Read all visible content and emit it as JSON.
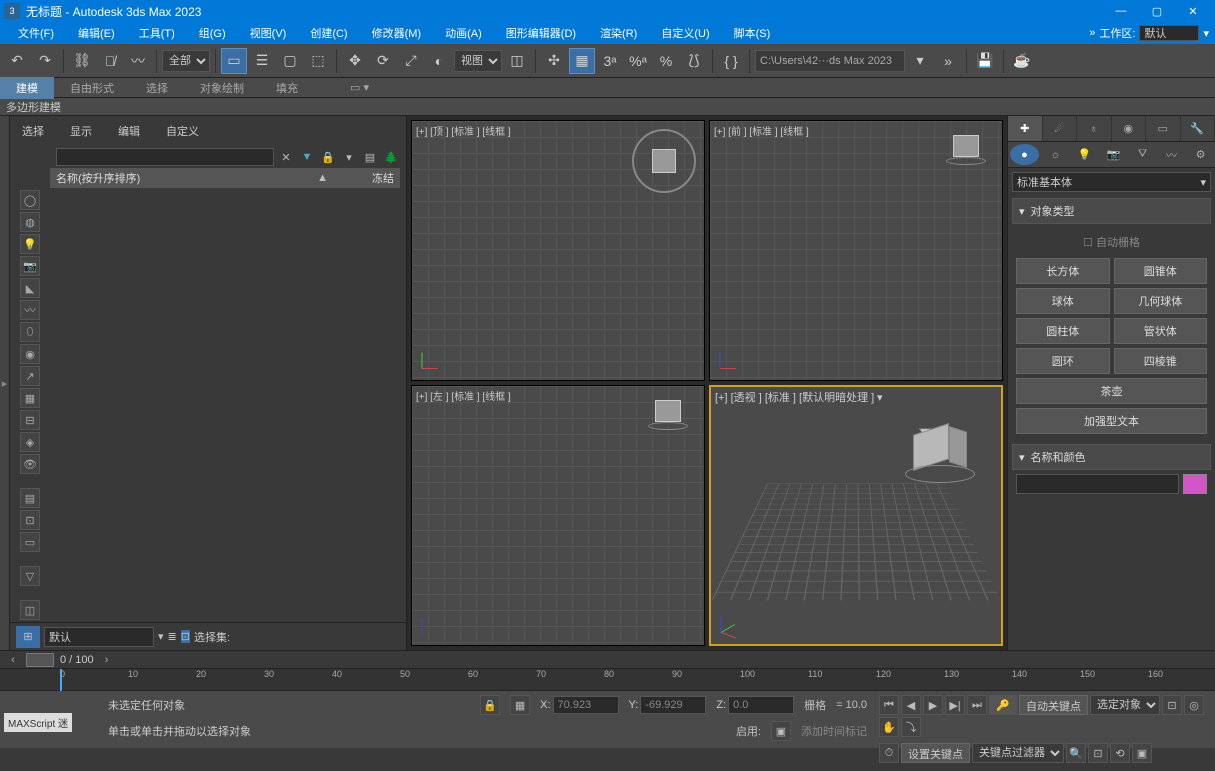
{
  "title": "无标题 - Autodesk 3ds Max 2023",
  "menu": [
    "文件(F)",
    "编辑(E)",
    "工具(T)",
    "组(G)",
    "视图(V)",
    "创建(C)",
    "修改器(M)",
    "动画(A)",
    "图形编辑器(D)",
    "渲染(R)",
    "自定义(U)",
    "脚本(S)"
  ],
  "workspace": {
    "label": "工作区:",
    "value": "默认"
  },
  "toolbar": {
    "filter": "全部",
    "refsys": "视图",
    "path": "C:\\Users\\42···ds Max 2023"
  },
  "ribbon": {
    "tabs": [
      "建模",
      "自由形式",
      "选择",
      "对象绘制",
      "填充"
    ],
    "sub": "多边形建模"
  },
  "scene": {
    "tabs": [
      "选择",
      "显示",
      "编辑",
      "自定义"
    ],
    "col_name": "名称(按升序排序)",
    "col_freeze": "冻结",
    "layer_default": "默认",
    "selset_label": "选择集:"
  },
  "viewports": {
    "top": "[+] [顶 ] [标准 ] [线框 ]",
    "front": "[+] [前 ] [标准 ] [线框 ]",
    "left": "[+] [左 ] [标准 ] [线框 ]",
    "persp": "[+]  [透视 ]  [标准 ]  [默认明暗处理 ]"
  },
  "cmd": {
    "category": "标准基本体",
    "rollout_objtype": "对象类型",
    "autogrid": "自动栅格",
    "buttons": [
      [
        "长方体",
        "圆锥体"
      ],
      [
        "球体",
        "几何球体"
      ],
      [
        "圆柱体",
        "管状体"
      ],
      [
        "圆环",
        "四棱锥"
      ],
      [
        "茶壶",
        ""
      ],
      [
        "加强型文本",
        ""
      ]
    ],
    "rollout_name": "名称和颜色",
    "name_value": ""
  },
  "time": {
    "frames": "0 / 100"
  },
  "ticks": [
    0,
    10,
    20,
    30,
    40,
    50,
    60,
    70,
    80,
    90,
    100,
    110,
    120,
    130,
    140,
    150,
    160
  ],
  "status": {
    "noobj": "未选定任何对象",
    "x": "70.923",
    "y": "-69.929",
    "z": "0.0",
    "grid_label": "栅格",
    "grid": "= 10.0",
    "hint": "单击或单击并拖动以选择对象",
    "enable": "启用:",
    "addtime": "添加时间标记",
    "maxscript": "MAXScript 迷",
    "autokey": "自动关键点",
    "selobj": "选定对象",
    "setkey": "设置关键点",
    "keyfilter": "关键点过滤器"
  }
}
